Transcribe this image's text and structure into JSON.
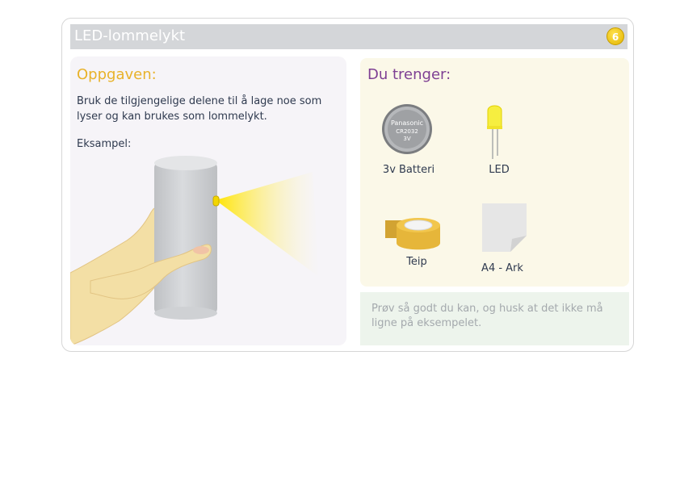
{
  "header": {
    "title": "LED-lommelykt",
    "step_badge": "6"
  },
  "task": {
    "heading": "Oppgaven:",
    "description": "Bruk de tilgjengelige delene til å lage noe som lyser og kan brukes som lommelykt.",
    "example_label": "Eksampel:"
  },
  "materials": {
    "heading": "Du trenger:",
    "items": [
      {
        "label": "3v Batteri",
        "icon": "coin-battery-icon",
        "battery_text": [
          "Panasonic",
          "CR2032",
          "3V"
        ]
      },
      {
        "label": "LED",
        "icon": "led-icon"
      },
      {
        "label": "Teip",
        "icon": "tape-roll-icon"
      },
      {
        "label": "A4 - Ark",
        "icon": "paper-sheet-icon"
      }
    ]
  },
  "tip": {
    "text": "Prøv så godt du kan, og husk at det ikke må ligne på eksempelet."
  },
  "colors": {
    "task_heading": "#e8b22a",
    "materials_heading": "#7e3f93",
    "body_text": "#2f3a4f",
    "tip_text": "#a4a9ad"
  }
}
